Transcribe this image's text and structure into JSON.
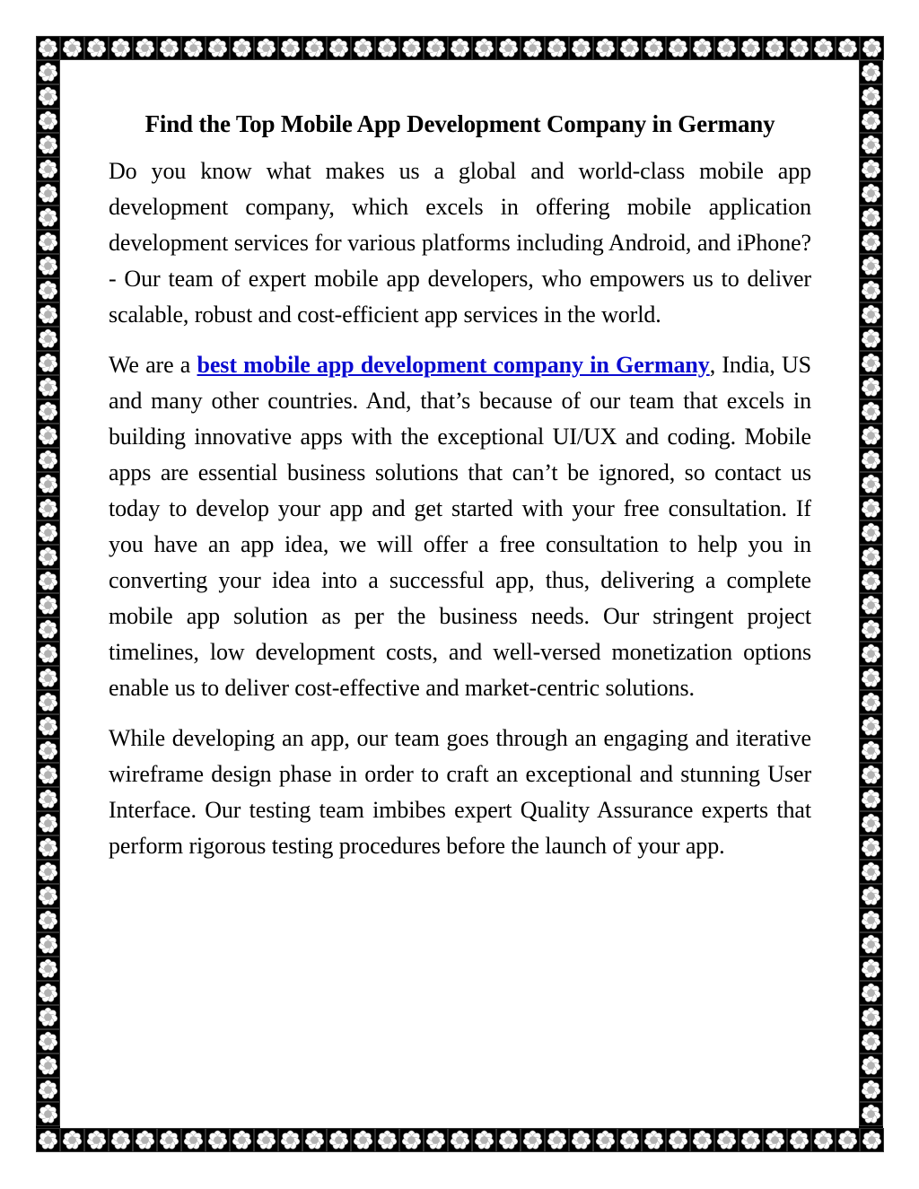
{
  "document": {
    "title": "Find the Top Mobile App Development Company in Germany",
    "paragraphs": [
      {
        "text": "Do you know what makes us a global and world-class mobile app development company, which excels in offering mobile application development services for various platforms including Android, and iPhone?- Our team of expert mobile app developers, who empowers us to deliver scalable, robust and cost-efficient app services in the world."
      },
      {
        "before_link": "We are a ",
        "link_text": "best mobile app development company in Germany",
        "after_link": ", India, US and many other countries. And, that’s because of our team that excels in building innovative apps with the exceptional UI/UX and coding. Mobile apps are essential business solutions that can’t be ignored, so contact us today to develop your app and get started with your free consultation. If you have an app idea, we will offer a free consultation to help you in converting your idea into a successful app, thus, delivering a complete mobile app solution as per the business needs. Our stringent project timelines, low development costs, and well-versed monetization options enable us to deliver cost-effective and market-centric solutions."
      },
      {
        "text": "While developing an app, our team goes through an engaging and iterative wireframe design phase in order to craft an exceptional and stunning User Interface. Our testing team imbibes expert Quality Assurance experts that perform rigorous testing procedures before the launch of your app."
      }
    ]
  },
  "border": {
    "icon": "flower-icon",
    "background_color": "#000000",
    "petal_color": "#ffffff",
    "center_color": "#b3b3b3"
  },
  "colors": {
    "link": "#0b0bd0",
    "text": "#000000"
  }
}
